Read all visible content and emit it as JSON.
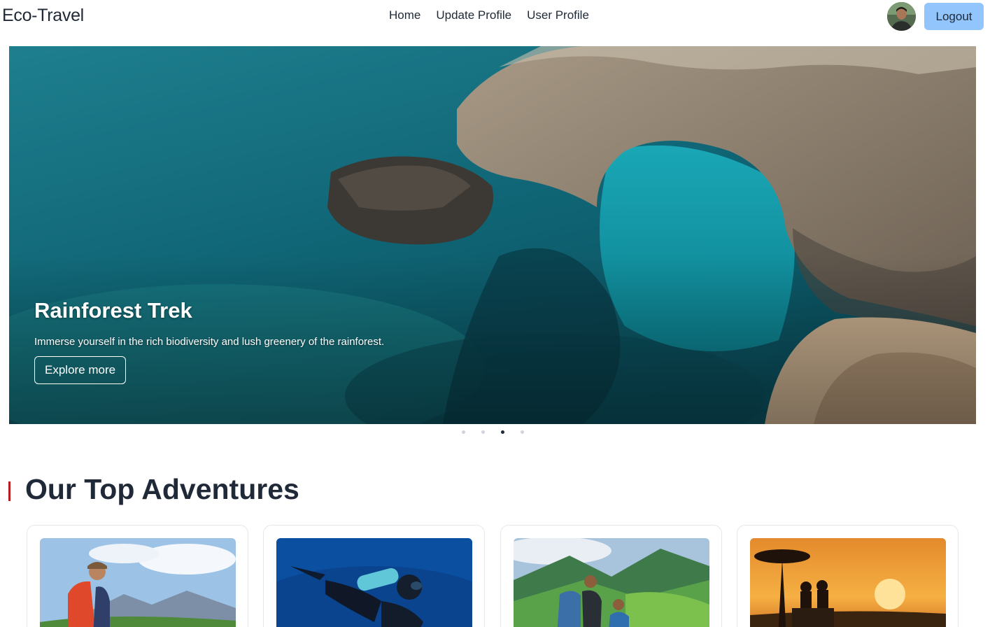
{
  "navbar": {
    "brand": "Eco-Travel",
    "links": [
      "Home",
      "Update Profile",
      "User Profile"
    ],
    "logout_label": "Logout"
  },
  "hero": {
    "title": "Rainforest Trek",
    "description": "Immerse yourself in the rich biodiversity and lush greenery of the rainforest.",
    "button_label": "Explore more",
    "slide_count": 4,
    "active_slide": 3
  },
  "section": {
    "title": "Our Top Adventures"
  },
  "cards": [
    {
      "image": "hiker-mountains"
    },
    {
      "image": "scuba-diver"
    },
    {
      "image": "hikers-valley"
    },
    {
      "image": "safari-sunset"
    }
  ],
  "colors": {
    "logout_bg": "#93c5fd",
    "section_accent": "#b91c1c",
    "text": "#1f2937"
  }
}
